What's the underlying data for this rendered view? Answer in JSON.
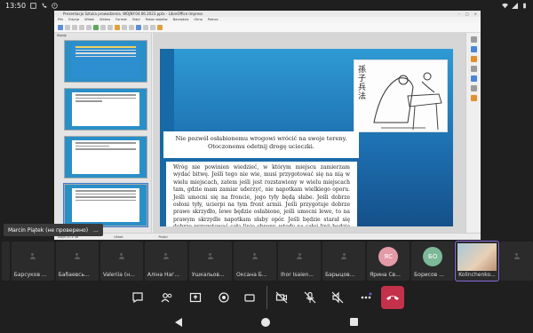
{
  "status_bar": {
    "time": "13:50"
  },
  "lo": {
    "window_title": "Prezentacja Sztuka prowadzenia. WOJNY.04.06.2023.pptx - LibreOffice Impress",
    "menu": [
      "Plik",
      "Edycja",
      "Widok",
      "Wstaw",
      "Format",
      "Slajd",
      "Pokaz slajdów",
      "Narzędzia",
      "Okno",
      "Pomoc"
    ],
    "pane_header": "Slajdy",
    "slide": {
      "caption": "Nie pozwól osłabionemu wrogowi wrócić na swoje tereny. Otoczonemu odetnij drogę ucieczki.",
      "body": "Wróg nie powinien wiedzieć, w którym miejscu zamierzam wydać bitwę. Jeśli tego nie wie, musi przygotować się na nią w wielu miejscach, zatem jeśli jest rozstawiony w wielu miejscach tam, gdzie mam zamiar uderzyć, nie napotkam wielkiego oporu. Jeśli umocni się na froncie, jego tyły będą słabe. Jeśli dobrze osłoni tyły, ucierpi na tym front armii. Jeśli przygotuje dobrze prawe skrzydło, lewe będzie osłabione, jeśli umocni lewe, to na prawym skrzydle napotkam słaby opór. Jeśli będzie starał się dobrze przygotować całą linię obrony, wtedy na całej linii będzie osłabiony.",
      "art_hanzi": "孫 子 兵 法"
    },
    "status": {
      "left": "Slajd 20 z 36",
      "center": "Układ",
      "right": "Polski"
    }
  },
  "presenter": {
    "name": "Marcin Piątek (не проверено)",
    "more": "..."
  },
  "participants": [
    {
      "name": "",
      "type": "empty"
    },
    {
      "name": "Барсуков ...",
      "type": "placeholder"
    },
    {
      "name": "Бабаевсь...",
      "type": "placeholder"
    },
    {
      "name": "Valeriia (н...",
      "type": "placeholder"
    },
    {
      "name": "Аліна Наг...",
      "type": "placeholder"
    },
    {
      "name": "Ушкальов...",
      "type": "placeholder"
    },
    {
      "name": "Оксана Б...",
      "type": "placeholder"
    },
    {
      "name": "Ihor Isaien...",
      "type": "placeholder"
    },
    {
      "name": "Барыцов...",
      "type": "placeholder"
    },
    {
      "name": "Ярина Св...",
      "type": "avatar",
      "initials": "ЯС",
      "color": "#e59aa8"
    },
    {
      "name": "Борисов ...",
      "type": "avatar",
      "initials": "БО",
      "color": "#7db898"
    },
    {
      "name": "Kolinchenko...",
      "type": "photo"
    },
    {
      "name": "",
      "type": "empty"
    }
  ],
  "colors": {
    "end_call": "#c4314b",
    "active_outline": "#8a6bd8"
  }
}
